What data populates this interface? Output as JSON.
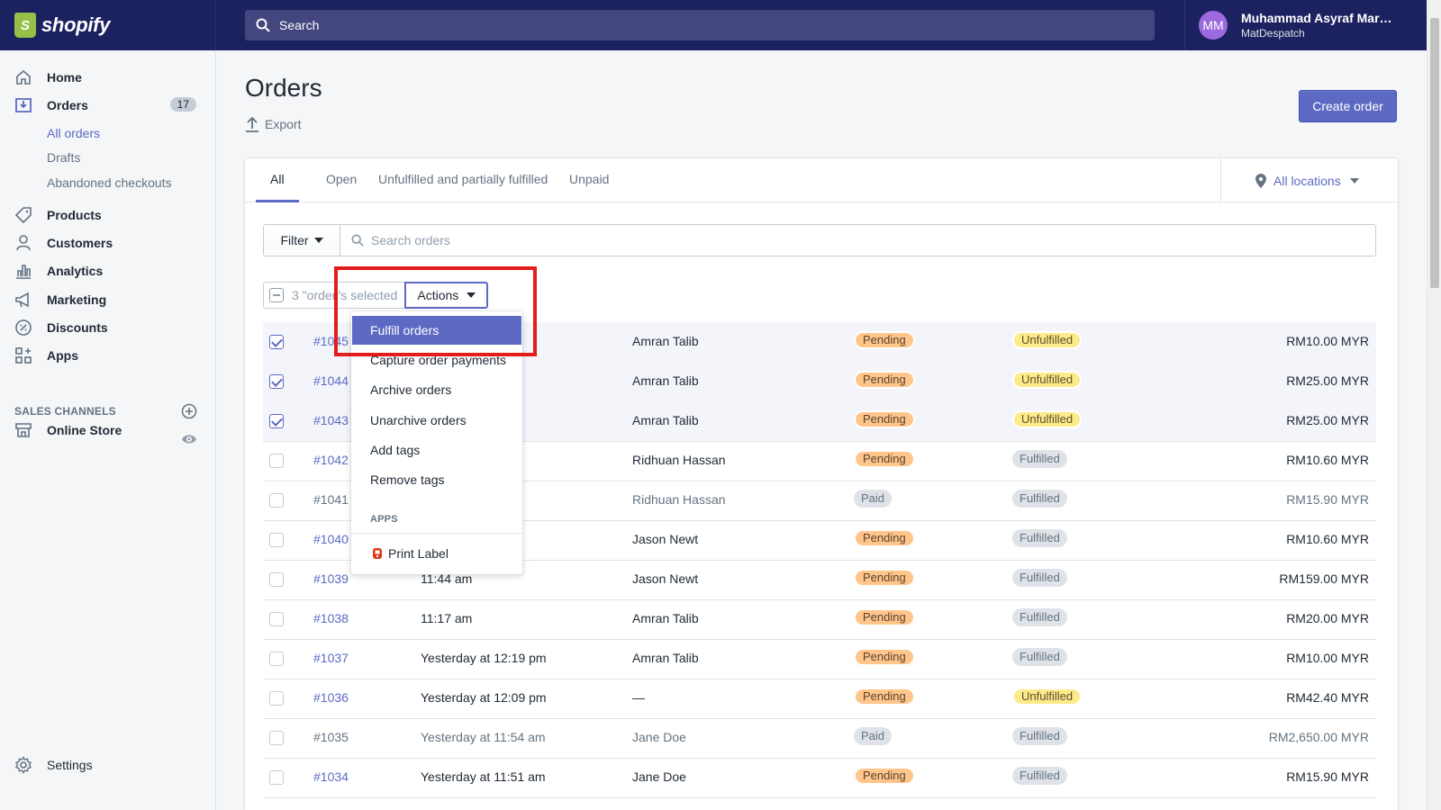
{
  "topbar": {
    "logo_text": "shopify",
    "search_placeholder": "Search",
    "user_initials": "MM",
    "user_name": "Muhammad Asyraf Mar…",
    "store_name": "MatDespatch"
  },
  "sidebar": {
    "home": "Home",
    "orders": "Orders",
    "orders_count": "17",
    "all_orders": "All orders",
    "drafts": "Drafts",
    "abandoned": "Abandoned checkouts",
    "products": "Products",
    "customers": "Customers",
    "analytics": "Analytics",
    "marketing": "Marketing",
    "discounts": "Discounts",
    "apps": "Apps",
    "sales_channels": "SALES CHANNELS",
    "online_store": "Online Store",
    "settings": "Settings"
  },
  "page": {
    "title": "Orders",
    "export": "Export",
    "create_order": "Create order"
  },
  "tabs": [
    "All",
    "Open",
    "Unfulfilled and partially fulfilled",
    "Unpaid"
  ],
  "locations": "All locations",
  "filter": {
    "label": "Filter",
    "search_placeholder": "Search orders"
  },
  "bulk": {
    "selected_text": "3 \"order\"s selected",
    "actions": "Actions"
  },
  "dropdown": {
    "items": [
      "Fulfill orders",
      "Capture order payments",
      "Archive orders",
      "Unarchive orders",
      "Add tags",
      "Remove tags"
    ],
    "section": "APPS",
    "app_item": "Print Label"
  },
  "orders": [
    {
      "id": "#1045",
      "date": "",
      "customer": "Amran Talib",
      "payment": "Pending",
      "fulfillment": "Unfulfilled",
      "total": "RM10.00 MYR",
      "checked": true
    },
    {
      "id": "#1044",
      "date": "",
      "customer": "Amran Talib",
      "payment": "Pending",
      "fulfillment": "Unfulfilled",
      "total": "RM25.00 MYR",
      "checked": true
    },
    {
      "id": "#1043",
      "date": "",
      "customer": "Amran Talib",
      "payment": "Pending",
      "fulfillment": "Unfulfilled",
      "total": "RM25.00 MYR",
      "checked": true
    },
    {
      "id": "#1042",
      "date": "",
      "customer": "Ridhuan Hassan",
      "payment": "Pending",
      "fulfillment": "Fulfilled",
      "total": "RM10.60 MYR",
      "checked": false
    },
    {
      "id": "#1041",
      "date": "",
      "customer": "Ridhuan Hassan",
      "payment": "Paid",
      "fulfillment": "Fulfilled",
      "total": "RM15.90 MYR",
      "checked": false
    },
    {
      "id": "#1040",
      "date": "",
      "customer": "Jason Newt",
      "payment": "Pending",
      "fulfillment": "Fulfilled",
      "total": "RM10.60 MYR",
      "checked": false
    },
    {
      "id": "#1039",
      "date": "11:44 am",
      "customer": "Jason Newt",
      "payment": "Pending",
      "fulfillment": "Fulfilled",
      "total": "RM159.00 MYR",
      "checked": false
    },
    {
      "id": "#1038",
      "date": "11:17 am",
      "customer": "Amran Talib",
      "payment": "Pending",
      "fulfillment": "Fulfilled",
      "total": "RM20.00 MYR",
      "checked": false
    },
    {
      "id": "#1037",
      "date": "Yesterday at 12:19 pm",
      "customer": "Amran Talib",
      "payment": "Pending",
      "fulfillment": "Fulfilled",
      "total": "RM10.00 MYR",
      "checked": false
    },
    {
      "id": "#1036",
      "date": "Yesterday at 12:09 pm",
      "customer": "—",
      "payment": "Pending",
      "fulfillment": "Unfulfilled",
      "total": "RM42.40 MYR",
      "checked": false
    },
    {
      "id": "#1035",
      "date": "Yesterday at 11:54 am",
      "customer": "Jane Doe",
      "payment": "Paid",
      "fulfillment": "Fulfilled",
      "total": "RM2,650.00 MYR",
      "checked": false
    },
    {
      "id": "#1034",
      "date": "Yesterday at 11:51 am",
      "customer": "Jane Doe",
      "payment": "Pending",
      "fulfillment": "Fulfilled",
      "total": "RM15.90 MYR",
      "checked": false
    }
  ],
  "colors": {
    "topbar": "#1c2260",
    "accent": "#5c6ac4",
    "pending": "#ffc58b",
    "unfulfilled": "#ffea8a",
    "highlight": "#e31c1c"
  }
}
